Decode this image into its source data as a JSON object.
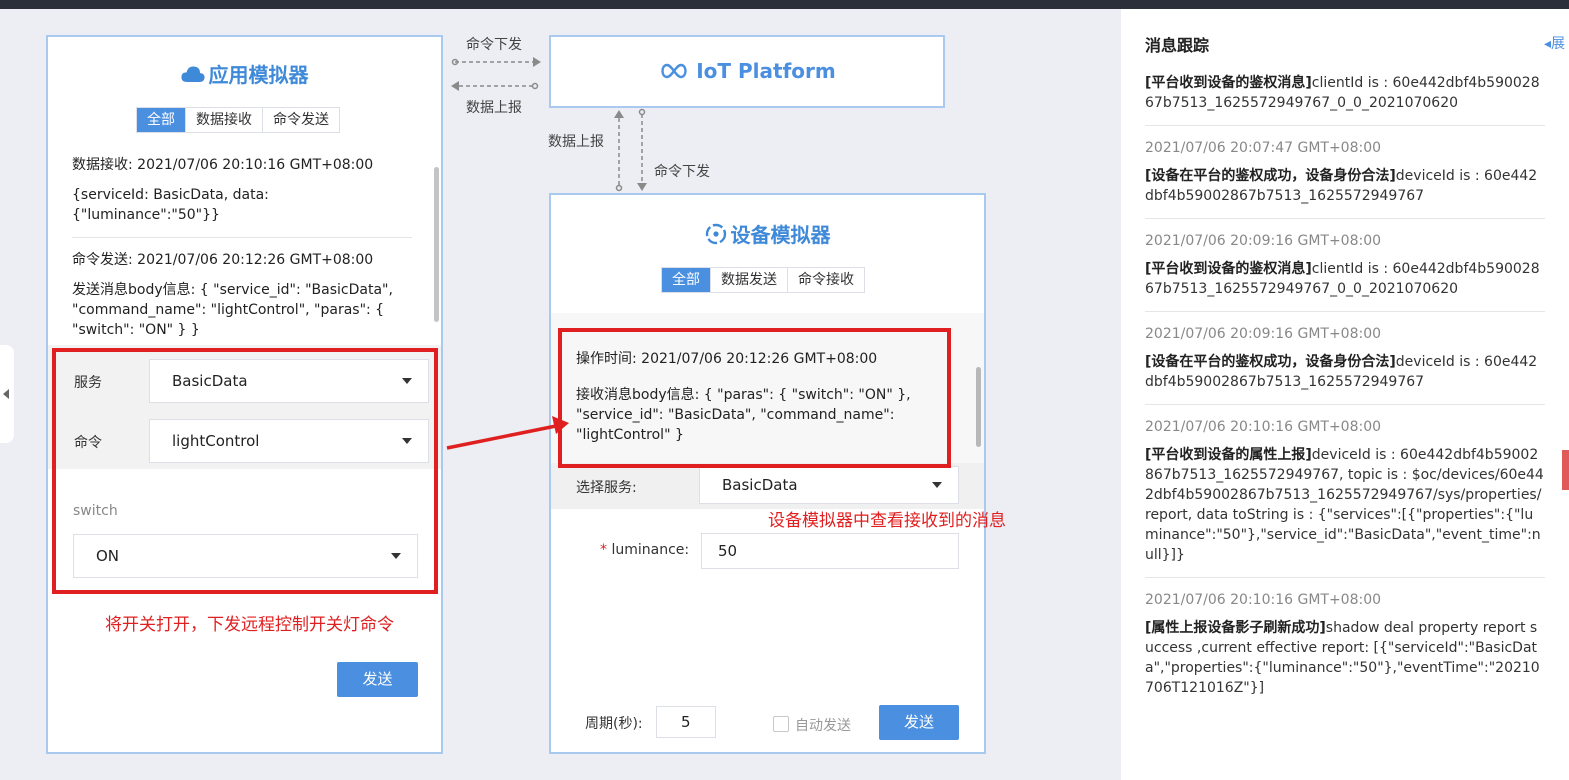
{
  "app_sim": {
    "title": "应用模拟器",
    "tabs": [
      "全部",
      "数据接收",
      "命令发送"
    ],
    "messages": [
      {
        "header": "数据接收: 2021/07/06 20:10:16 GMT+08:00",
        "body": "{serviceId: BasicData, data: {\"luminance\":\"50\"}}"
      },
      {
        "header": "命令发送: 2021/07/06 20:12:26 GMT+08:00",
        "body": "发送消息body信息: { \"service_id\": \"BasicData\", \"command_name\": \"lightControl\", \"paras\": { \"switch\": \"ON\" } }"
      }
    ],
    "service_label": "服务",
    "service_value": "BasicData",
    "command_label": "命令",
    "command_value": "lightControl",
    "switch_label": "switch",
    "switch_value": "ON",
    "send_label": "发送"
  },
  "connectors": {
    "cmd_down": "命令下发",
    "data_up": "数据上报",
    "data_up_v": "数据上报",
    "cmd_down_v": "命令下发"
  },
  "iot": {
    "title": "IoT Platform"
  },
  "dev_sim": {
    "title": "设备模拟器",
    "tabs": [
      "全部",
      "数据发送",
      "命令接收"
    ],
    "op_time": "操作时间: 2021/07/06 20:12:26 GMT+08:00",
    "recv_body": "接收消息body信息: { \"paras\": { \"switch\": \"ON\" }, \"service_id\": \"BasicData\", \"command_name\": \"lightControl\" }",
    "select_service_label": "选择服务:",
    "select_service_value": "BasicData",
    "required_mark": "*",
    "luminance_label": "luminance:",
    "luminance_value": "50",
    "period_label": "周期(秒):",
    "period_value": "5",
    "auto_send_label": "自动发送",
    "send_label": "发送"
  },
  "annotations": {
    "left_note": "将开关打开，下发远程控制开关灯命令",
    "right_note": "设备模拟器中查看接收到的消息",
    "color": "#e02020"
  },
  "trace": {
    "title": "消息跟踪",
    "expand": "◂展",
    "items": [
      {
        "time": "",
        "tag": "[平台收到设备的鉴权消息]",
        "text": "clientId is : 60e442dbf4b59002867b7513_1625572949767_0_0_2021070620"
      },
      {
        "time": "2021/07/06 20:07:47 GMT+08:00",
        "tag": "[设备在平台的鉴权成功，设备身份合法]",
        "text": "deviceId is : 60e442dbf4b59002867b7513_1625572949767"
      },
      {
        "time": "2021/07/06 20:09:16 GMT+08:00",
        "tag": "[平台收到设备的鉴权消息]",
        "text": "clientId is : 60e442dbf4b59002867b7513_1625572949767_0_0_2021070620"
      },
      {
        "time": "2021/07/06 20:09:16 GMT+08:00",
        "tag": "[设备在平台的鉴权成功，设备身份合法]",
        "text": "deviceId is : 60e442dbf4b59002867b7513_1625572949767"
      },
      {
        "time": "2021/07/06 20:10:16 GMT+08:00",
        "tag": "[平台收到设备的属性上报]",
        "text": "deviceId is : 60e442dbf4b59002867b7513_1625572949767, topic is : $oc/devices/60e442dbf4b59002867b7513_1625572949767/sys/properties/report, data toString is : {\"services\":[{\"properties\":{\"luminance\":\"50\"},\"service_id\":\"BasicData\",\"event_time\":null}]}"
      },
      {
        "time": "2021/07/06 20:10:16 GMT+08:00",
        "tag": "[属性上报设备影子刷新成功]",
        "text": "shadow deal property report success ,current effective report: [{\"serviceId\":\"BasicData\",\"properties\":{\"luminance\":\"50\"},\"eventTime\":\"20210706T121016Z\"}]"
      }
    ]
  },
  "colors": {
    "accent": "#4a8fe0",
    "panel_border": "#a9c9ee"
  }
}
